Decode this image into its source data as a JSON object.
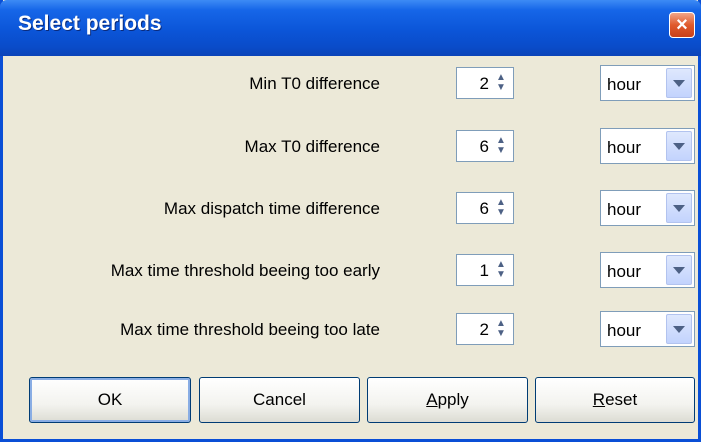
{
  "window": {
    "title": "Select periods"
  },
  "rows": [
    {
      "label": "Min T0 difference",
      "value": "2",
      "unit": "hour"
    },
    {
      "label": "Max T0 difference",
      "value": "6",
      "unit": "hour"
    },
    {
      "label": "Max dispatch time difference",
      "value": "6",
      "unit": "hour"
    },
    {
      "label": "Max time threshold beeing too early",
      "value": "1",
      "unit": "hour"
    },
    {
      "label": "Max time threshold beeing too late",
      "value": "2",
      "unit": "hour"
    }
  ],
  "buttons": {
    "ok": "OK",
    "cancel": "Cancel",
    "apply": {
      "mnemonic": "A",
      "rest": "pply"
    },
    "reset": {
      "mnemonic": "R",
      "rest": "eset"
    }
  },
  "icons": {
    "close": "close-icon",
    "spin": "spin-arrows-icon",
    "dropdown": "chevron-down-icon"
  }
}
